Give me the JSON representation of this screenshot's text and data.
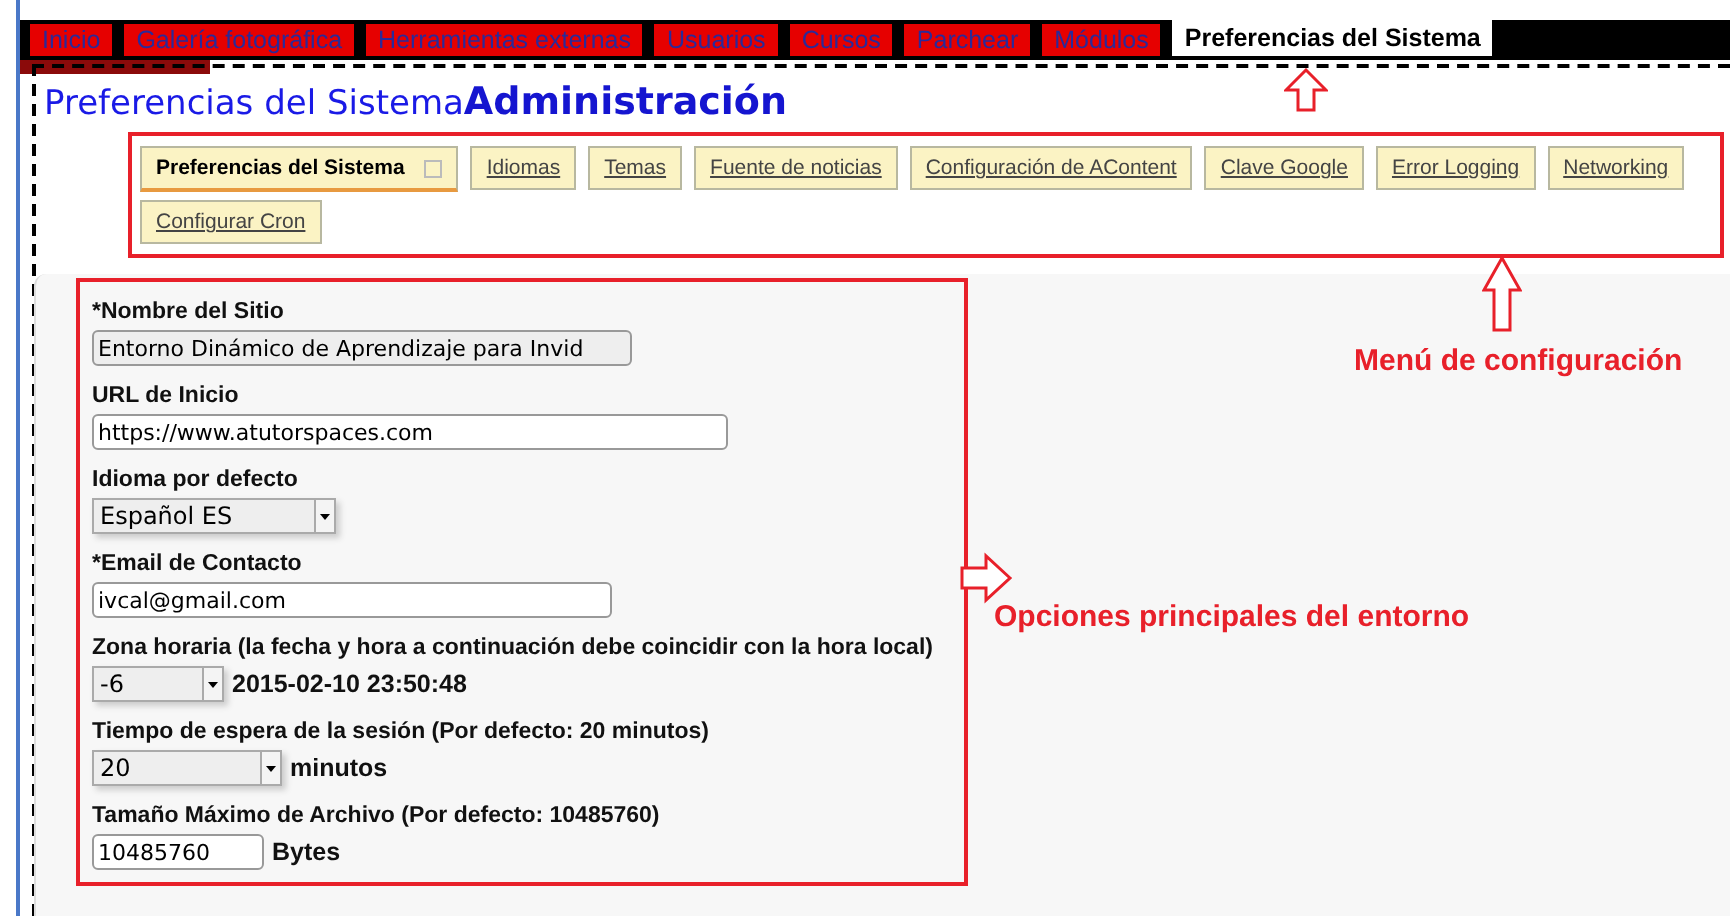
{
  "top_tabs": [
    {
      "label": "Inicio",
      "selected": false
    },
    {
      "label": "Galería fotográfica",
      "selected": false
    },
    {
      "label": "Herramientas externas",
      "selected": false
    },
    {
      "label": "Usuarios",
      "selected": false
    },
    {
      "label": "Cursos",
      "selected": false
    },
    {
      "label": "Parchear",
      "selected": false
    },
    {
      "label": "Módulos",
      "selected": false
    },
    {
      "label": "Preferencias del Sistema",
      "selected": true
    }
  ],
  "page_title": "Preferencias del Sistema",
  "section_title": "Administración",
  "sub_tabs": [
    {
      "label": "Preferencias del Sistema",
      "selected": true
    },
    {
      "label": "Idiomas",
      "selected": false
    },
    {
      "label": "Temas",
      "selected": false
    },
    {
      "label": "Fuente de noticias",
      "selected": false
    },
    {
      "label": "Configuración de AContent",
      "selected": false
    },
    {
      "label": "Clave Google",
      "selected": false
    },
    {
      "label": "Error Logging",
      "selected": false
    },
    {
      "label": "Networking",
      "selected": false
    },
    {
      "label": "Configurar Cron",
      "selected": false
    }
  ],
  "fields": [
    {
      "label": "*Nombre del Sitio",
      "kind": "text",
      "value": "Entorno Dinámico de Aprendizaje para Invid",
      "disabled": true
    },
    {
      "label": "URL de Inicio",
      "kind": "text",
      "value": "https://www.atutorspaces.com",
      "disabled": false
    },
    {
      "label": "Idioma por defecto",
      "kind": "select",
      "value": "Español ES"
    },
    {
      "label": "*Email de Contacto",
      "kind": "text",
      "value": "ivcal@gmail.com",
      "disabled": false
    },
    {
      "label": "Zona horaria (la fecha y hora a continuación debe coincidir con la hora local)",
      "kind": "select",
      "value": "-6",
      "suffix": "2015-02-10 23:50:48"
    },
    {
      "label": "Tiempo de espera de la sesión (Por defecto: 20 minutos)",
      "kind": "select",
      "value": "20",
      "suffix": "minutos"
    },
    {
      "label": "Tamaño Máximo de Archivo (Por defecto: 10485760)",
      "kind": "text",
      "value": "10485760",
      "disabled": false,
      "suffix": "Bytes"
    }
  ],
  "annotations": {
    "menu_label": "Menú de configuración",
    "options_label": "Opciones principales del entorno"
  }
}
